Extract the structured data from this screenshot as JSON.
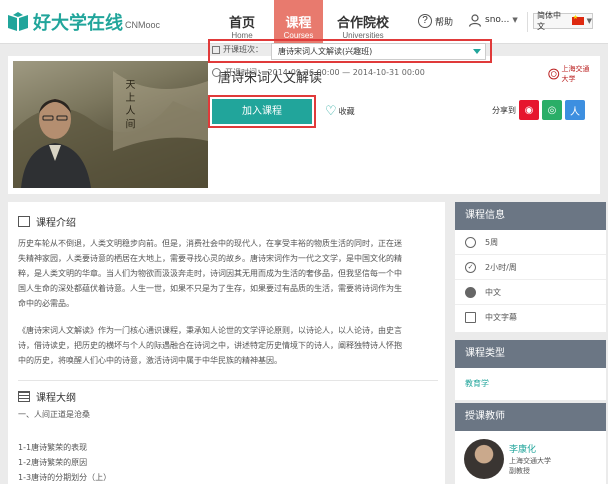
{
  "nav": {
    "logo_text": "好大学在线",
    "logo_sub": "CNMooc",
    "items": [
      {
        "zh": "首页",
        "en": "Home"
      },
      {
        "zh": "课程",
        "en": "Courses"
      },
      {
        "zh": "合作院校",
        "en": "Universities"
      }
    ],
    "help": "帮助",
    "user": "sno...",
    "lang": "简体中文"
  },
  "course": {
    "title": "唐诗宋词人文解读",
    "university": "上海交通大学",
    "term_label": "开课班次：",
    "term_value": "唐诗宋词人文解读(兴趣班)",
    "time": "开课时间：  2014-09-26 00:00 — 2014-10-31 00:00",
    "join": "加入课程",
    "fav": "收藏",
    "share": "分享到",
    "hero_poem_line": "天   上    人   间"
  },
  "intro": {
    "title": "课程介绍",
    "p1": [
      "历史车轮从不倒退，人类文明稳步向前。但是，消费社会中的现代人，在享受丰裕的物质生活的同时，正在迷",
      "失精神家园，人类要诗意的栖居在大地上，需要寻找心灵的故乡。唐诗宋词作为一代之文学，是中国文化的精",
      "粹，是人类文明的华章。当人们为物欲而汲汲奔走时，诗词因其无用而成为生活的奢侈品，但我坚信每一个中",
      "国人生命的深处都蕴伏着诗意。人生一世，如果不只是为了生存，如果要过有品质的生活，需要将诗词作为生",
      "命中的必需品。"
    ],
    "p2": [
      "《唐诗宋词人文解读》作为一门核心通识课程，秉承知人论世的文学评论原则，以诗论人，以人论诗，由史言",
      "诗，借诗读史，把历史的横坏与个人的际遇融合在诗词之中，讲述特定历史情境下的诗人，阐释独特诗人怀抱",
      "中的历史，将唤醒人们心中的诗意，激活诗词中属于中华民族的精神基因。"
    ]
  },
  "outline": {
    "title": "课程大纲",
    "chapter": "一、人间正道是沧桑",
    "items": [
      "1-1唐诗繁荣的表现",
      "1-2唐诗繁荣的原因",
      "1-3唐诗的分期划分（上）"
    ]
  },
  "info": {
    "title": "课程信息",
    "rows": [
      "5周",
      "2小时/周",
      "中文",
      "中文字幕"
    ]
  },
  "type": {
    "title": "课程类型",
    "value": "教育学"
  },
  "teacher": {
    "title": "授课教师",
    "name": "李康化",
    "org": "上海交通大学",
    "rank": "副教授"
  },
  "colors": {
    "accent": "#21a59b",
    "nav_active": "#e87a6e",
    "highlight": "#e03a3a",
    "side_header": "#6b7684"
  }
}
